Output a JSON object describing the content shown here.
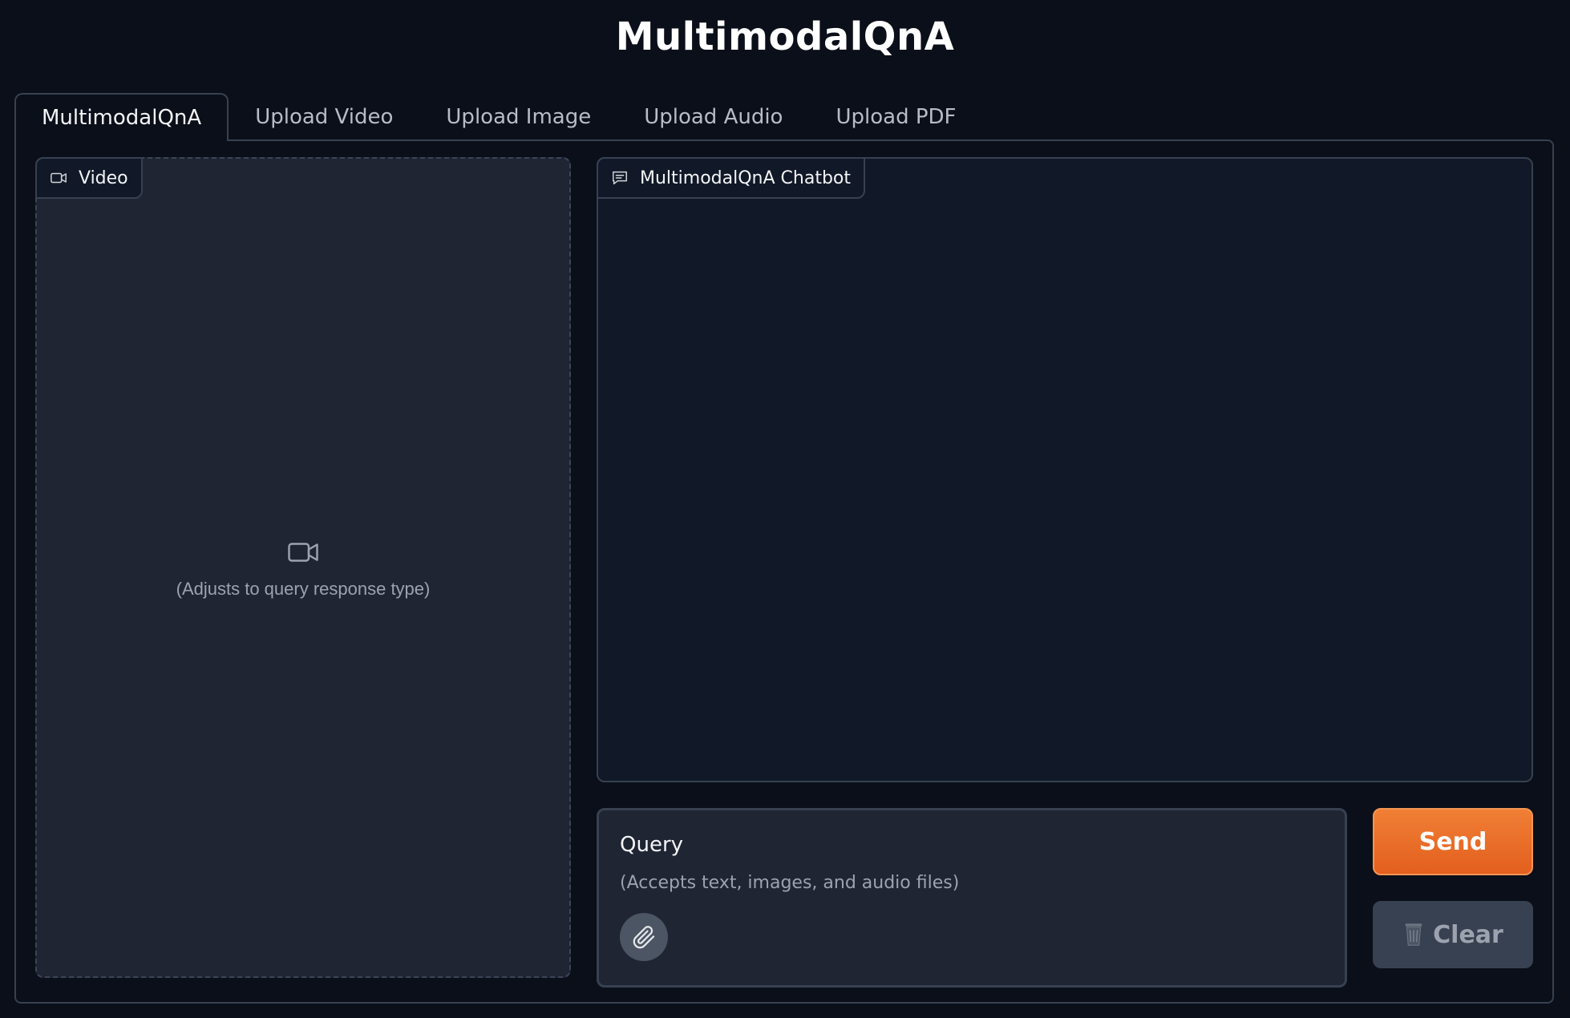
{
  "app": {
    "title": "MultimodalQnA"
  },
  "tabs": [
    {
      "label": "MultimodalQnA",
      "active": true
    },
    {
      "label": "Upload Video",
      "active": false
    },
    {
      "label": "Upload Image",
      "active": false
    },
    {
      "label": "Upload Audio",
      "active": false
    },
    {
      "label": "Upload PDF",
      "active": false
    }
  ],
  "video_panel": {
    "label": "Video",
    "icon": "video-camera-icon",
    "placeholder": "(Adjusts to query response type)"
  },
  "chatbot": {
    "label": "MultimodalQnA Chatbot",
    "icon": "chat-bubble-icon"
  },
  "query": {
    "title": "Query",
    "placeholder": "(Accepts text, images, and audio files)",
    "value": "",
    "attach_icon": "paperclip-icon"
  },
  "buttons": {
    "send_label": "Send",
    "clear_label": "Clear",
    "clear_icon": "wastebasket-icon"
  },
  "colors": {
    "background": "#0b0f19",
    "panel": "#1f2533",
    "chat_background": "#111827",
    "border": "#374151",
    "accent": "#e8692a"
  }
}
